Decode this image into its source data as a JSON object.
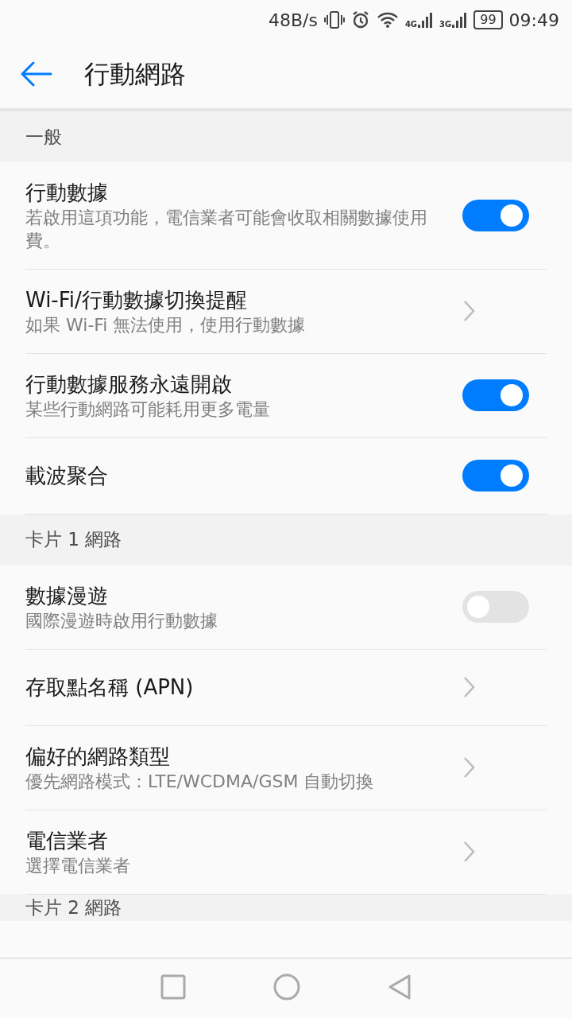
{
  "status_bar": {
    "speed": "48B/s",
    "network_1": "4G",
    "network_2": "3G",
    "battery": "99",
    "time": "09:49"
  },
  "header": {
    "title": "行動網路"
  },
  "sections": [
    {
      "title": "一般",
      "items": [
        {
          "kind": "toggle",
          "title": "行動數據",
          "subtitle": "若啟用這項功能，電信業者可能會收取相關數據使用費。",
          "on": true
        },
        {
          "kind": "link",
          "title": "Wi-Fi/行動數據切換提醒",
          "subtitle": "如果 Wi-Fi 無法使用，使用行動數據"
        },
        {
          "kind": "toggle",
          "title": "行動數據服務永遠開啟",
          "subtitle": "某些行動網路可能耗用更多電量",
          "on": true
        },
        {
          "kind": "toggle",
          "title": "載波聚合",
          "on": true
        }
      ]
    },
    {
      "title": "卡片 1 網路",
      "items": [
        {
          "kind": "toggle",
          "title": "數據漫遊",
          "subtitle": "國際漫遊時啟用行動數據",
          "on": false
        },
        {
          "kind": "link",
          "title": "存取點名稱 (APN)"
        },
        {
          "kind": "link",
          "title": "偏好的網路類型",
          "subtitle": "優先網路模式：LTE/WCDMA/GSM 自動切換"
        },
        {
          "kind": "link",
          "title": "電信業者",
          "subtitle": "選擇電信業者"
        }
      ]
    },
    {
      "title": "卡片 2 網路"
    }
  ]
}
